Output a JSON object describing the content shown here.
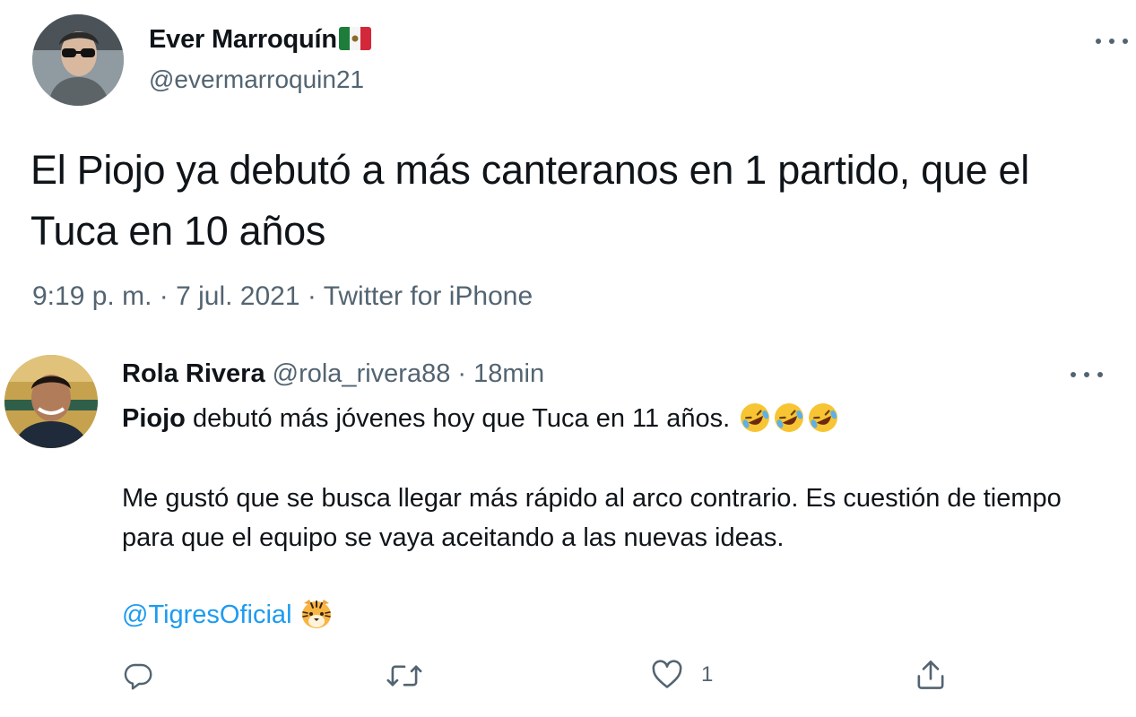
{
  "tweet": {
    "author_name": "Ever Marroquín",
    "author_handle": "@evermarroquin21",
    "text": "El Piojo ya debutó a más canteranos en 1 partido, que el Tuca en 10 años",
    "time": "9:19 p. m.",
    "date": "7 jul. 2021",
    "source": "Twitter for iPhone",
    "separator": "·"
  },
  "reply": {
    "author_name": "Rola Rivera",
    "author_handle": "@rola_rivera88",
    "separator": "·",
    "time_ago": "18min",
    "line1_bold": "Piojo",
    "line1_rest": " debutó más jóvenes hoy que Tuca en 11 años.",
    "paragraph": "Me gustó que se busca llegar más rápido al arco contrario. Es cuestión de tiempo para que el equipo se vaya aceitando a las nuevas ideas.",
    "mention": "@TigresOficial",
    "like_count": "1"
  },
  "icons": {
    "flag": "mexico-flag-icon",
    "laugh": "rolling-on-floor-laughing-emoji",
    "tiger": "tiger-face-emoji",
    "reply": "reply-icon",
    "retweet": "retweet-icon",
    "like": "heart-icon",
    "share": "share-icon",
    "more": "more-options-icon"
  },
  "colors": {
    "text": "#0f1419",
    "secondary": "#536471",
    "link": "#1d9bf0",
    "background": "#ffffff"
  }
}
